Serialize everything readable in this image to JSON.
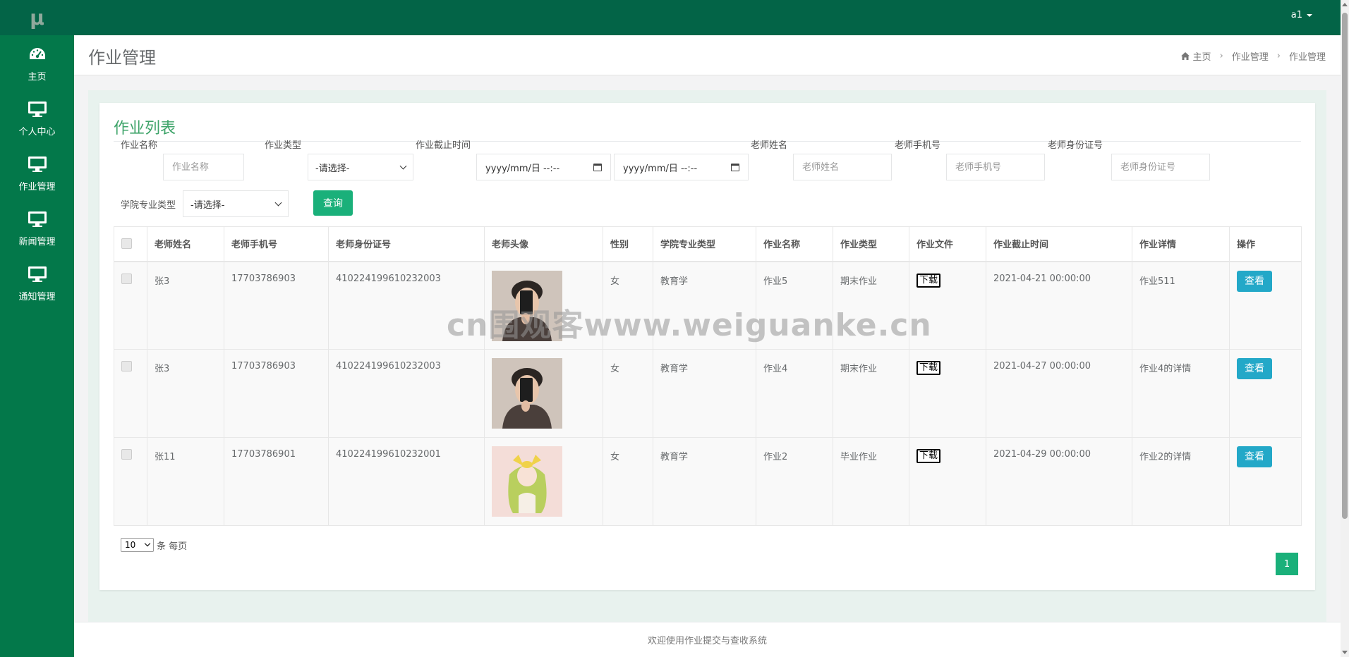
{
  "logo": "μ",
  "sidebar": {
    "items": [
      {
        "label": "主页",
        "icon": "dashboard-icon"
      },
      {
        "label": "个人中心",
        "icon": "monitor-icon"
      },
      {
        "label": "作业管理",
        "icon": "monitor-icon"
      },
      {
        "label": "新闻管理",
        "icon": "monitor-icon"
      },
      {
        "label": "通知管理",
        "icon": "monitor-icon"
      }
    ]
  },
  "topbar": {
    "user": "a1"
  },
  "header": {
    "title": "作业管理",
    "breadcrumb": [
      "主页",
      "作业管理",
      "作业管理"
    ]
  },
  "panel": {
    "title": "作业列表"
  },
  "search": {
    "name_label": "作业名称",
    "name_placeholder": "作业名称",
    "type_label": "作业类型",
    "type_value": "-请选择-",
    "deadline_label": "作业截止时间",
    "date_from": "yyyy/mm/日 --:--",
    "date_to": "yyyy/mm/日 --:--",
    "teacher_name_label": "老师姓名",
    "teacher_name_placeholder": "老师姓名",
    "teacher_phone_label": "老师手机号",
    "teacher_phone_placeholder": "老师手机号",
    "teacher_id_label": "老师身份证号",
    "teacher_id_placeholder": "老师身份证号",
    "major_label": "学院专业类型",
    "major_value": "-请选择-",
    "query_button": "查询"
  },
  "table": {
    "headers": [
      "老师姓名",
      "老师手机号",
      "老师身份证号",
      "老师头像",
      "性别",
      "学院专业类型",
      "作业名称",
      "作业类型",
      "作业文件",
      "作业截止时间",
      "作业详情",
      "操作"
    ],
    "download_label": "下载",
    "view_label": "查看",
    "rows": [
      {
        "name": "张3",
        "phone": "17703786903",
        "id_card": "410224199610232003",
        "avatar": "avatar-boy",
        "gender": "女",
        "major": "教育学",
        "hw_name": "作业5",
        "hw_type": "期末作业",
        "deadline": "2021-04-21 00:00:00",
        "detail": "作业511"
      },
      {
        "name": "张3",
        "phone": "17703786903",
        "id_card": "410224199610232003",
        "avatar": "avatar-boy",
        "gender": "女",
        "major": "教育学",
        "hw_name": "作业4",
        "hw_type": "期末作业",
        "deadline": "2021-04-27 00:00:00",
        "detail": "作业4的详情"
      },
      {
        "name": "张11",
        "phone": "17703786901",
        "id_card": "410224199610232001",
        "avatar": "avatar-anime-girl",
        "gender": "女",
        "major": "教育学",
        "hw_name": "作业2",
        "hw_type": "毕业作业",
        "deadline": "2021-04-29 00:00:00",
        "detail": "作业2的详情"
      }
    ]
  },
  "pagination": {
    "page_size": "10",
    "page_size_suffix": "条 每页",
    "current_page": "1"
  },
  "footer": {
    "text": "欢迎使用作业提交与查收系统"
  },
  "watermark": "cn围观客www.weiguanke.cn",
  "colors": {
    "sidebar": "#03784a",
    "topbar": "#036447",
    "accent": "#1ab07a",
    "info": "#23a8c8"
  }
}
